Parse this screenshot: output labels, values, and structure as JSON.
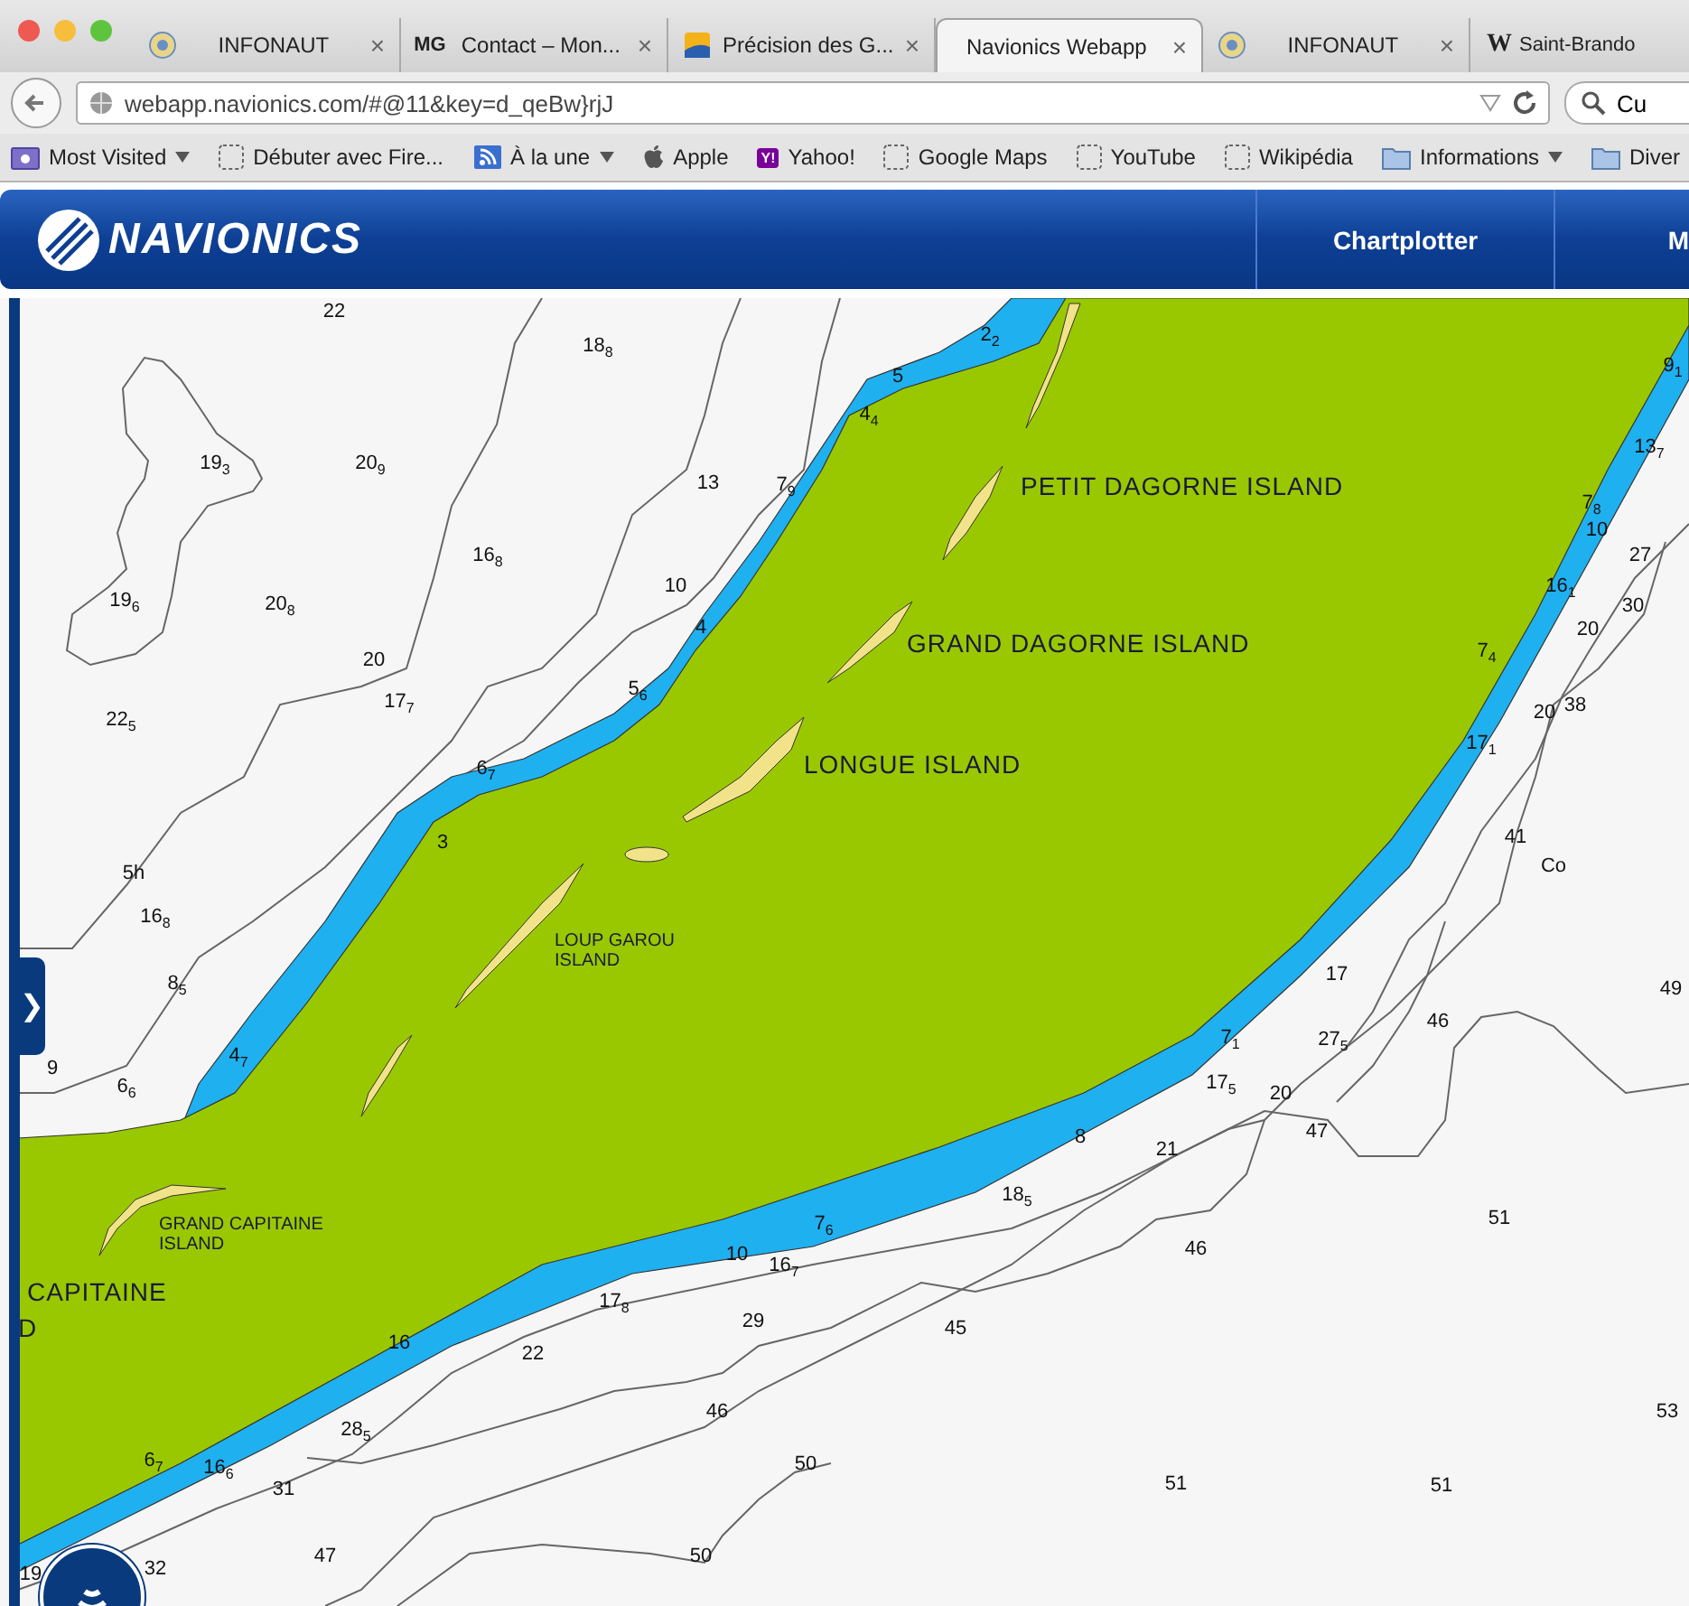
{
  "browser": {
    "tabs": [
      {
        "title": "INFONAUT",
        "kind": "seal",
        "selected": false
      },
      {
        "title": "Contact – Mon...",
        "kind": "letters",
        "selected": false
      },
      {
        "title": "Précision des G...",
        "kind": "wave",
        "selected": false
      },
      {
        "title": "Navionics Webapp",
        "kind": "none",
        "selected": true
      },
      {
        "title": "INFONAUT",
        "kind": "seal",
        "selected": false
      },
      {
        "title": "Saint-Brando",
        "kind": "wiki",
        "selected": false
      }
    ],
    "favicon_letters": "MG",
    "wiki_letter": "W",
    "close_glyph": "×",
    "address": {
      "url": "webapp.navionics.com/#@11&key=d_qeBw}rjJ"
    },
    "search": {
      "value": "Cu"
    },
    "bookmarks": [
      {
        "label": "Most Visited",
        "kind": "smart",
        "dropdown": true
      },
      {
        "label": "Débuter avec Fire...",
        "kind": "page",
        "dropdown": false
      },
      {
        "label": "À la une",
        "kind": "feed",
        "dropdown": true
      },
      {
        "label": "Apple",
        "kind": "apple",
        "dropdown": false
      },
      {
        "label": "Yahoo!",
        "kind": "yahoo",
        "dropdown": false
      },
      {
        "label": "Google Maps",
        "kind": "page",
        "dropdown": false
      },
      {
        "label": "YouTube",
        "kind": "page",
        "dropdown": false
      },
      {
        "label": "Wikipédia",
        "kind": "page",
        "dropdown": false
      },
      {
        "label": "Informations",
        "kind": "folder",
        "dropdown": true
      },
      {
        "label": "Diver",
        "kind": "folder",
        "dropdown": false
      }
    ],
    "yahoo_glyph": "Y!"
  },
  "header": {
    "logo": "NAVIONICS",
    "nav": [
      {
        "label": "Chartplotter"
      },
      {
        "label": "M"
      }
    ]
  },
  "map": {
    "panel_toggle": "❯",
    "island_labels": [
      {
        "text": "PETIT DAGORNE ISLAND",
        "kind": "major"
      },
      {
        "text": "GRAND DAGORNE ISLAND",
        "kind": "major"
      },
      {
        "text": "LONGUE ISLAND",
        "kind": "major"
      },
      {
        "text": "LOUP GAROU ISLAND",
        "kind": "minor"
      },
      {
        "text": "GRAND CAPITAINE ISLAND",
        "kind": "minor"
      },
      {
        "text": "CAPITAINE",
        "kind": "major"
      },
      {
        "text": "D",
        "kind": "major"
      }
    ],
    "soundings": [
      "22",
      "18$_{8}$",
      "2$_{2}$",
      "5",
      "4$_{4}$",
      "9$_{1}$",
      "13$_{7}$",
      "19$_{3}$",
      "20$_{9}$",
      "13",
      "7$_{9}$",
      "7$_{8}$",
      "10",
      "16$_{8}$",
      "27",
      "10",
      "16$_{1}$",
      "19$_{6}$",
      "20$_{8}$",
      "30",
      "4",
      "20",
      "20",
      "7$_{4}$",
      "5$_{6}$",
      "17$_{7}$",
      "38",
      "20",
      "22$_{5}$",
      "17$_{1}$",
      "6$_{7}$",
      "41",
      "Co",
      "3",
      "5h",
      "16$_{8}$",
      "17",
      "49",
      "8$_{5}$",
      "46",
      "7$_{1}$",
      "27$_{5}$",
      "9",
      "4$_{7}$",
      "6$_{6}$",
      "17$_{5}$",
      "20",
      "47",
      "8",
      "21",
      "18$_{5}$",
      "51",
      "7$_{6}$",
      "46",
      "10",
      "16$_{7}$",
      "17$_{8}$",
      "29",
      "45",
      "16",
      "22",
      "46",
      "53",
      "28$_{5}$",
      "6$_{7}$",
      "16$_{6}$",
      "31",
      "50",
      "51",
      "51",
      "47",
      "50",
      "32",
      "19"
    ]
  }
}
